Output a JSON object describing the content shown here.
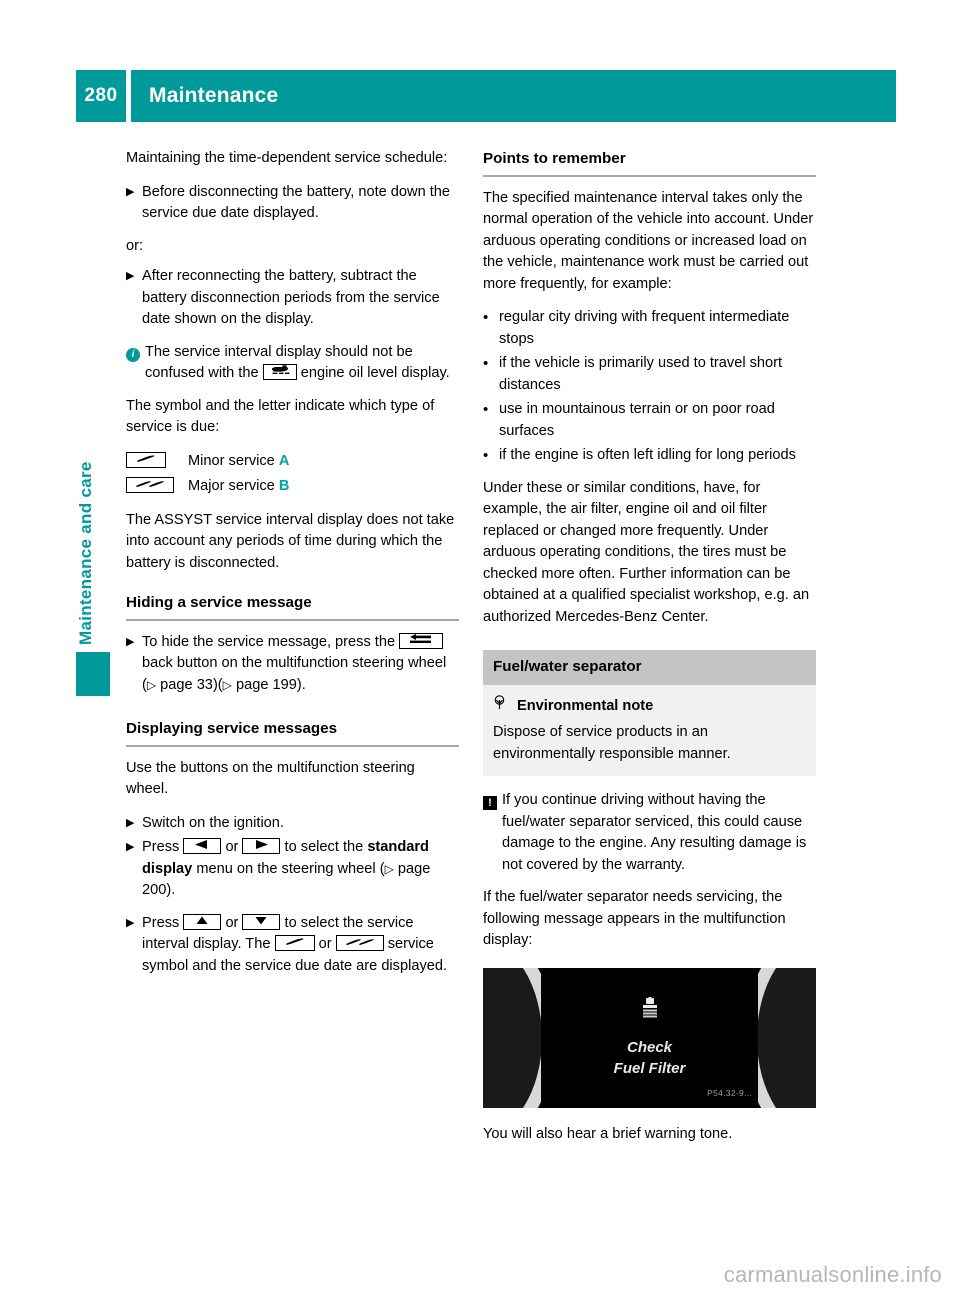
{
  "header": {
    "page_number": "280",
    "title": "Maintenance",
    "accent_color": "#009a9a"
  },
  "side_tab": {
    "label": "Maintenance and care"
  },
  "left_column": {
    "intro": "Maintaining the time-dependent service schedule:",
    "step_before": "Before disconnecting the battery, note down the service due date displayed.",
    "or_label": "or:",
    "step_after": "After reconnecting the battery, subtract the battery disconnection periods from the service date shown on the display.",
    "info_note_part1": "The service interval display should not be confused with the",
    "info_note_part2": "engine oil level display.",
    "symbol_intro": "The symbol and the letter indicate which type of service is due:",
    "minor_service_label": "Minor service",
    "minor_service_letter": "A",
    "major_service_label": "Major service",
    "major_service_letter": "B",
    "assyst_note": "The ASSYST service interval display does not take into account any periods of time during which the battery is disconnected.",
    "hiding_heading": "Hiding a service message",
    "hiding_step_part1": "To hide the service message, press the",
    "hiding_step_part2": "back button on the multifunction steering wheel (",
    "hiding_step_page1": "page 33",
    "hiding_step_mid": ")(",
    "hiding_step_page2": "page 199",
    "hiding_step_end": ").",
    "displaying_heading": "Displaying service messages",
    "displaying_intro": "Use the buttons on the multifunction steering wheel.",
    "step_ignition": "Switch on the ignition.",
    "step_press_lr_1": "Press",
    "step_press_or": "or",
    "step_press_lr_2": "to select the",
    "step_press_bold": "standard display",
    "step_press_lr_3": "menu on the steering wheel (",
    "step_press_page": "page 200",
    "step_press_lr_4": ").",
    "step_press_ud_1": "Press",
    "step_press_ud_2": "to select the service interval display.",
    "step_press_ud_3": "The",
    "step_press_ud_4": "service symbol and the service due date are displayed."
  },
  "right_column": {
    "points_heading": "Points to remember",
    "points_intro": "The specified maintenance interval takes only the normal operation of the vehicle into account. Under arduous operating conditions or increased load on the vehicle, maintenance work must be carried out more frequently, for example:",
    "bullets": [
      "regular city driving with frequent intermediate stops",
      "if the vehicle is primarily used to travel short distances",
      "use in mountainous terrain or on poor road surfaces",
      "if the engine is often left idling for long periods"
    ],
    "conditions_para": "Under these or similar conditions, have, for example, the air filter, engine oil and oil filter replaced or changed more frequently. Under arduous operating conditions, the tires must be checked more often. Further information can be obtained at a qualified specialist workshop, e.g. an authorized Mercedes-Benz Center.",
    "fuel_banner": "Fuel/water separator",
    "eco_note_heading": "Environmental note",
    "eco_note_body": "Dispose of service products in an environmentally responsible manner.",
    "warning_body": "If you continue driving without having the fuel/water separator serviced, this could cause damage to the engine. Any resulting damage is not covered by the warranty.",
    "needs_servicing": "If the fuel/water separator needs servicing, the following message appears in the multifunction display:",
    "cluster": {
      "line1": "Check",
      "line2": "Fuel Filter",
      "watermark": "P54.32-9..."
    },
    "closing": "You will also hear a brief warning tone."
  },
  "footer": {
    "watermark": "carmanualsonline.info"
  },
  "icons": {
    "arrow_bullet": "▶",
    "dot_bullet": "•",
    "page_arrow": "▷",
    "info": "i",
    "warning": "!",
    "eco": "♁"
  }
}
